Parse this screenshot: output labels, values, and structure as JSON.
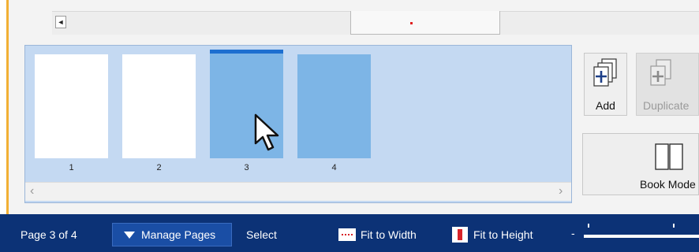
{
  "pages": [
    {
      "number": "1",
      "state": "white"
    },
    {
      "number": "2",
      "state": "white"
    },
    {
      "number": "3",
      "state": "selected"
    },
    {
      "number": "4",
      "state": "blue"
    }
  ],
  "toolbar": {
    "add_label": "Add",
    "duplicate_label": "Duplicate",
    "book_mode_label": "Book Mode"
  },
  "status": {
    "page_indicator": "Page 3 of 4",
    "manage_pages_label": "Manage Pages",
    "select_label": "Select",
    "fit_width_label": "Fit to Width",
    "fit_height_label": "Fit to Height",
    "zoom_minus": "-"
  },
  "icons": {
    "scroll_left": "scroll-left-arrow-icon",
    "add": "add-page-icon",
    "duplicate": "duplicate-page-icon",
    "book": "book-icon",
    "manage": "triangle-down-icon",
    "fit_width": "fit-width-icon",
    "fit_height": "fit-height-icon",
    "cursor": "mouse-pointer-icon"
  },
  "colors": {
    "thumb_panel_bg": "#c4d9f2",
    "page_selected": "#7db5e6",
    "selection_bar": "#1d6fd0",
    "status_bar_bg": "#0c3276",
    "accent_orange": "#f2b035"
  }
}
